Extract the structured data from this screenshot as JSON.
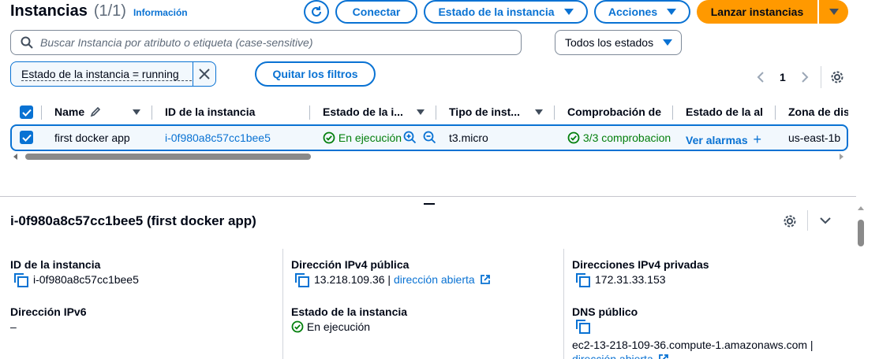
{
  "header": {
    "title": "Instancias",
    "count": "(1/1)",
    "info_link": "Información",
    "connect_label": "Conectar",
    "instance_state_label": "Estado de la instancia",
    "actions_label": "Acciones",
    "launch_label": "Lanzar instancias"
  },
  "search": {
    "placeholder": "Buscar Instancia por atributo o etiqueta (case-sensitive)",
    "state_filter": "Todos los estados"
  },
  "filters": {
    "token": "Estado de la instancia = running",
    "clear_label": "Quitar los filtros"
  },
  "pagination": {
    "page": "1"
  },
  "table": {
    "columns": [
      "Name",
      "ID de la instancia",
      "Estado de la i...",
      "Tipo de inst...",
      "Comprobación de",
      "Estado de la ala",
      "Zona de dis"
    ],
    "row": {
      "name": "first docker app",
      "instance_id": "i-0f980a8c57cc1bee5",
      "state": "En ejecución",
      "type": "t3.micro",
      "checks": "3/3 comprobacion",
      "alarms": "Ver alarmas",
      "zone": "us-east-1b"
    }
  },
  "details": {
    "title": "i-0f980a8c57cc1bee5 (first docker app)",
    "id_label": "ID de la instancia",
    "id_value": "i-0f980a8c57cc1bee5",
    "ipv6_label": "Dirección IPv6",
    "ipv6_value": "–",
    "public_ip_label": "Dirección IPv4 pública",
    "public_ip_value": "13.218.109.36",
    "open_address": "dirección abierta",
    "state_label": "Estado de la instancia",
    "state_value": "En ejecución",
    "private_ip_label": "Direcciones IPv4 privadas",
    "private_ip_value": "172.31.33.153",
    "dns_label": "DNS público",
    "dns_value": "ec2-13-218-109-36.compute-1.amazonaws.com |",
    "dns_open": "dirección abierta"
  },
  "colors": {
    "accent": "#0972d3",
    "primary": "#ff9900",
    "success": "#037f0c"
  }
}
